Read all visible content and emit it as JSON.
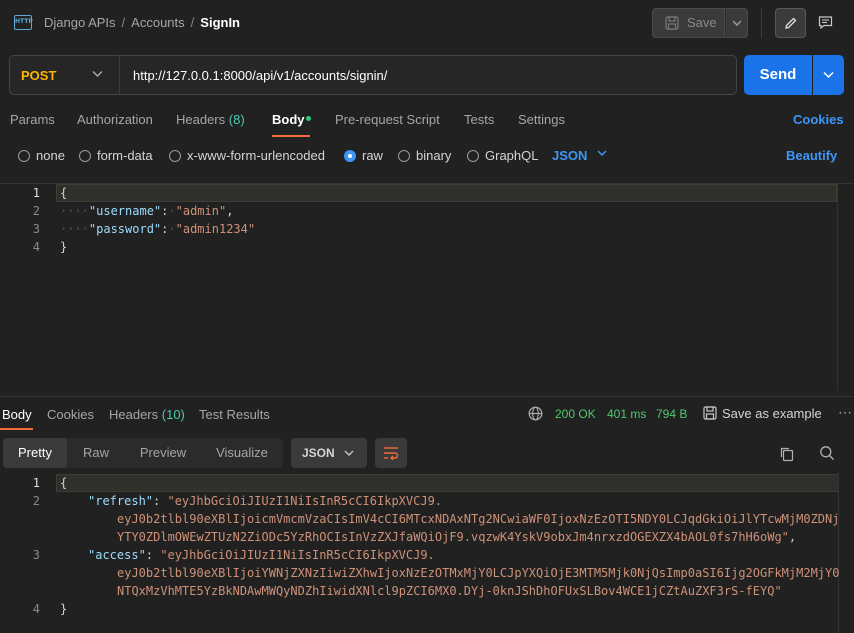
{
  "header": {
    "breadcrumb": [
      "Django APIs",
      "Accounts",
      "SignIn"
    ],
    "http_icon_label": "HTTP",
    "save_label": "Save"
  },
  "request": {
    "method": "POST",
    "url": "http://127.0.0.1:8000/api/v1/accounts/signin/",
    "send_label": "Send"
  },
  "tabs": {
    "params": "Params",
    "authorization": "Authorization",
    "headers": "Headers",
    "headers_count": "(8)",
    "body": "Body",
    "prerequest": "Pre-request Script",
    "tests": "Tests",
    "settings": "Settings",
    "cookies": "Cookies"
  },
  "body_types": {
    "none": "none",
    "form_data": "form-data",
    "urlencoded": "x-www-form-urlencoded",
    "raw": "raw",
    "binary": "binary",
    "graphql": "GraphQL",
    "format": "JSON",
    "beautify": "Beautify",
    "selected": "raw"
  },
  "request_body": {
    "line_numbers": [
      "1",
      "2",
      "3",
      "4"
    ],
    "open_brace": "{",
    "close_brace": "}",
    "username_key": "\"username\"",
    "username_value": "\"admin\"",
    "password_key": "\"password\"",
    "password_value": "\"admin1234\""
  },
  "response": {
    "tabs": {
      "body": "Body",
      "cookies": "Cookies",
      "headers": "Headers",
      "headers_count": "(10)",
      "test_results": "Test Results"
    },
    "status": "200 OK",
    "time": "401 ms",
    "size": "794 B",
    "save_example": "Save as example",
    "views": {
      "pretty": "Pretty",
      "raw": "Raw",
      "preview": "Preview",
      "visualize": "Visualize"
    },
    "format": "JSON",
    "line_numbers": [
      "1",
      "2",
      "3",
      "4"
    ],
    "open_brace": "{",
    "close_brace": "}",
    "refresh_key": "\"refresh\"",
    "refresh_line1": "\"eyJhbGciOiJIUzI1NiIsInR5cCI6IkpXVCJ9.",
    "refresh_line2": "eyJ0b2tlbl90eXBlIjoicmVmcmVzaCIsImV4cCI6MTcxNDAxNTg2NCwiaWF0IjoxNzEzOTI5NDY0LCJqdGkiOiJlYTcwMjM0ZDNj",
    "refresh_line3": "YTY0ZDlmOWEwZTUzN2ZiODc5YzRhOCIsInVzZXJfaWQiOjF9.vqzwK4YskV9obxJm4nrxzdOGEXZX4bAOL0fs7hH6oWg\"",
    "access_key": "\"access\"",
    "access_line1": "\"eyJhbGciOiJIUzI1NiIsInR5cCI6IkpXVCJ9.",
    "access_line2": "eyJ0b2tlbl90eXBlIjoiYWNjZXNzIiwiZXhwIjoxNzEzOTMxMjY0LCJpYXQiOjE3MTM5Mjk0NjQsImp0aSI6Ijg2OGFkMjM2MjY0",
    "access_line3": "NTQxMzVhMTE5YzBkNDAwMWQyNDZhIiwidXNlcl9pZCI6MX0.DYj-0knJShDhOFUxSLBov4WCE1jCZtAuZXF3rS-fEYQ\""
  },
  "colors": {
    "accent": "#1a73e8",
    "method": "#ffb400",
    "status_ok": "#4ec96b",
    "tab_underline": "#f26b3a",
    "json_key": "#9cdcfe",
    "json_string": "#ce9178"
  }
}
